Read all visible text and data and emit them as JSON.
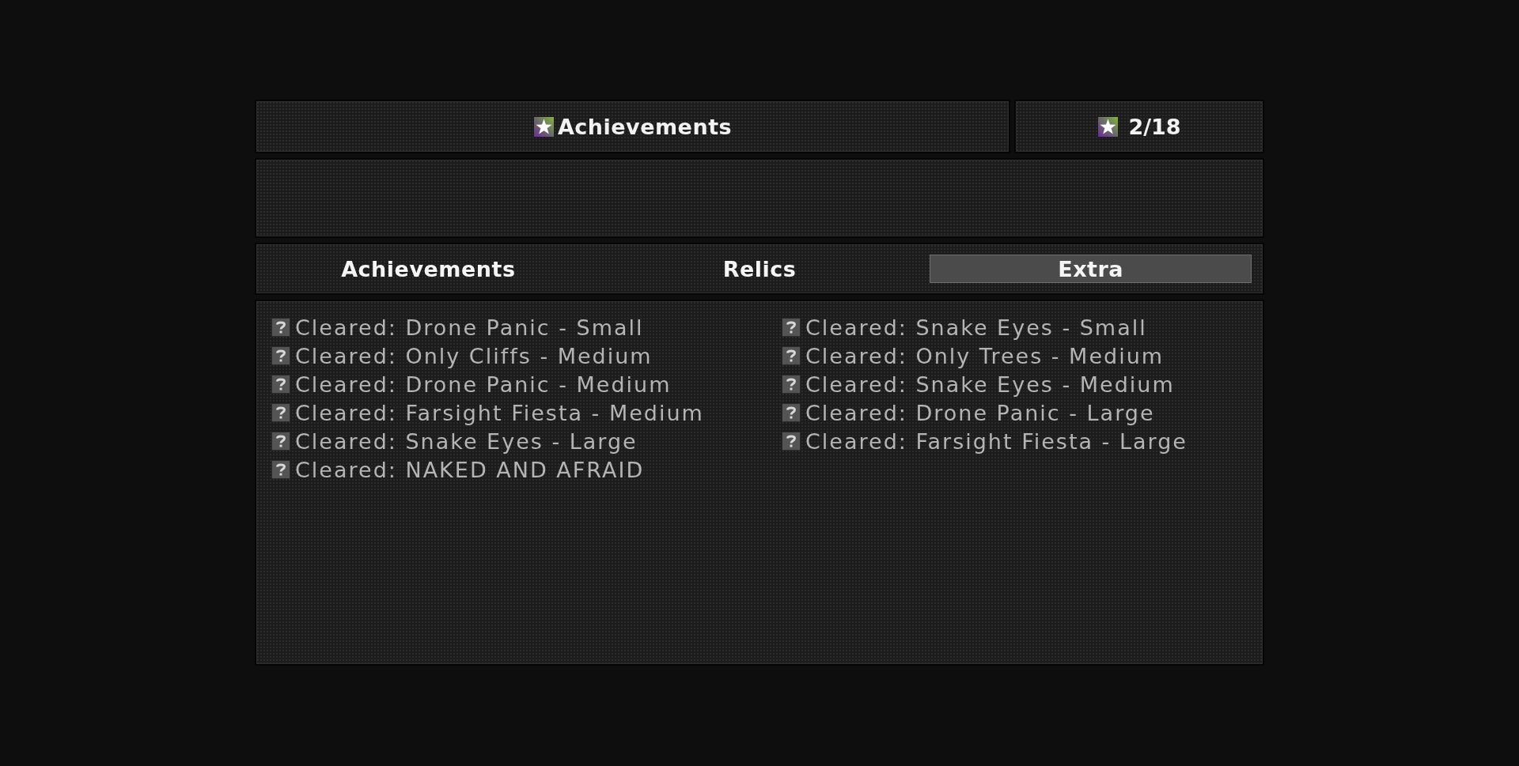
{
  "header": {
    "title": "Achievements",
    "counter": "2/18"
  },
  "tabs": [
    {
      "label": "Achievements",
      "selected": false
    },
    {
      "label": "Relics",
      "selected": false
    },
    {
      "label": "Extra",
      "selected": true
    }
  ],
  "achievements": [
    {
      "label": "Cleared: Drone Panic - Small",
      "unlocked": false
    },
    {
      "label": "Cleared: Snake Eyes - Small",
      "unlocked": false
    },
    {
      "label": "Cleared: Only Cliffs - Medium",
      "unlocked": false
    },
    {
      "label": "Cleared: Only Trees - Medium",
      "unlocked": false
    },
    {
      "label": "Cleared: Drone Panic - Medium",
      "unlocked": false
    },
    {
      "label": "Cleared: Snake Eyes - Medium",
      "unlocked": false
    },
    {
      "label": "Cleared: Farsight Fiesta - Medium",
      "unlocked": false
    },
    {
      "label": "Cleared: Drone Panic - Large",
      "unlocked": false
    },
    {
      "label": "Cleared: Snake Eyes - Large",
      "unlocked": false
    },
    {
      "label": "Cleared: Farsight Fiesta - Large",
      "unlocked": false
    },
    {
      "label": "Cleared: NAKED AND AFRAID",
      "unlocked": false
    }
  ]
}
